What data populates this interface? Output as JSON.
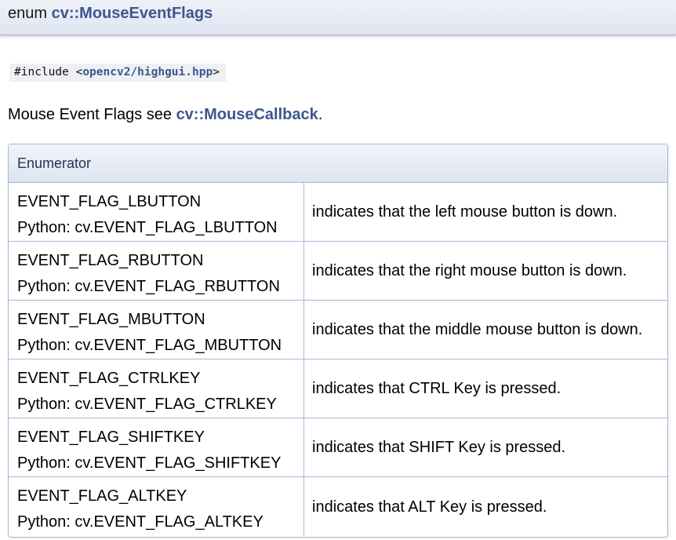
{
  "header": {
    "prefix": "enum ",
    "name": "cv::MouseEventFlags"
  },
  "include": {
    "directive": "#include <",
    "path": "opencv2/highgui.hpp",
    "suffix": ">"
  },
  "description": {
    "text": "Mouse Event Flags see ",
    "link": "cv::MouseCallback",
    "suffix": "."
  },
  "table": {
    "header": "Enumerator",
    "rows": [
      {
        "name": "EVENT_FLAG_LBUTTON",
        "python": "Python: cv.EVENT_FLAG_LBUTTON",
        "doc": "indicates that the left mouse button is down."
      },
      {
        "name": "EVENT_FLAG_RBUTTON",
        "python": "Python: cv.EVENT_FLAG_RBUTTON",
        "doc": "indicates that the right mouse button is down."
      },
      {
        "name": "EVENT_FLAG_MBUTTON",
        "python": "Python: cv.EVENT_FLAG_MBUTTON",
        "doc": "indicates that the middle mouse button is down."
      },
      {
        "name": "EVENT_FLAG_CTRLKEY",
        "python": "Python: cv.EVENT_FLAG_CTRLKEY",
        "doc": "indicates that CTRL Key is pressed."
      },
      {
        "name": "EVENT_FLAG_SHIFTKEY",
        "python": "Python: cv.EVENT_FLAG_SHIFTKEY",
        "doc": "indicates that SHIFT Key is pressed."
      },
      {
        "name": "EVENT_FLAG_ALTKEY",
        "python": "Python: cv.EVENT_FLAG_ALTKEY",
        "doc": "indicates that ALT Key is pressed."
      }
    ]
  },
  "colors": {
    "link": "#3d578c",
    "border": "#a8b8d9",
    "header_bg": "#dfe5f1"
  }
}
